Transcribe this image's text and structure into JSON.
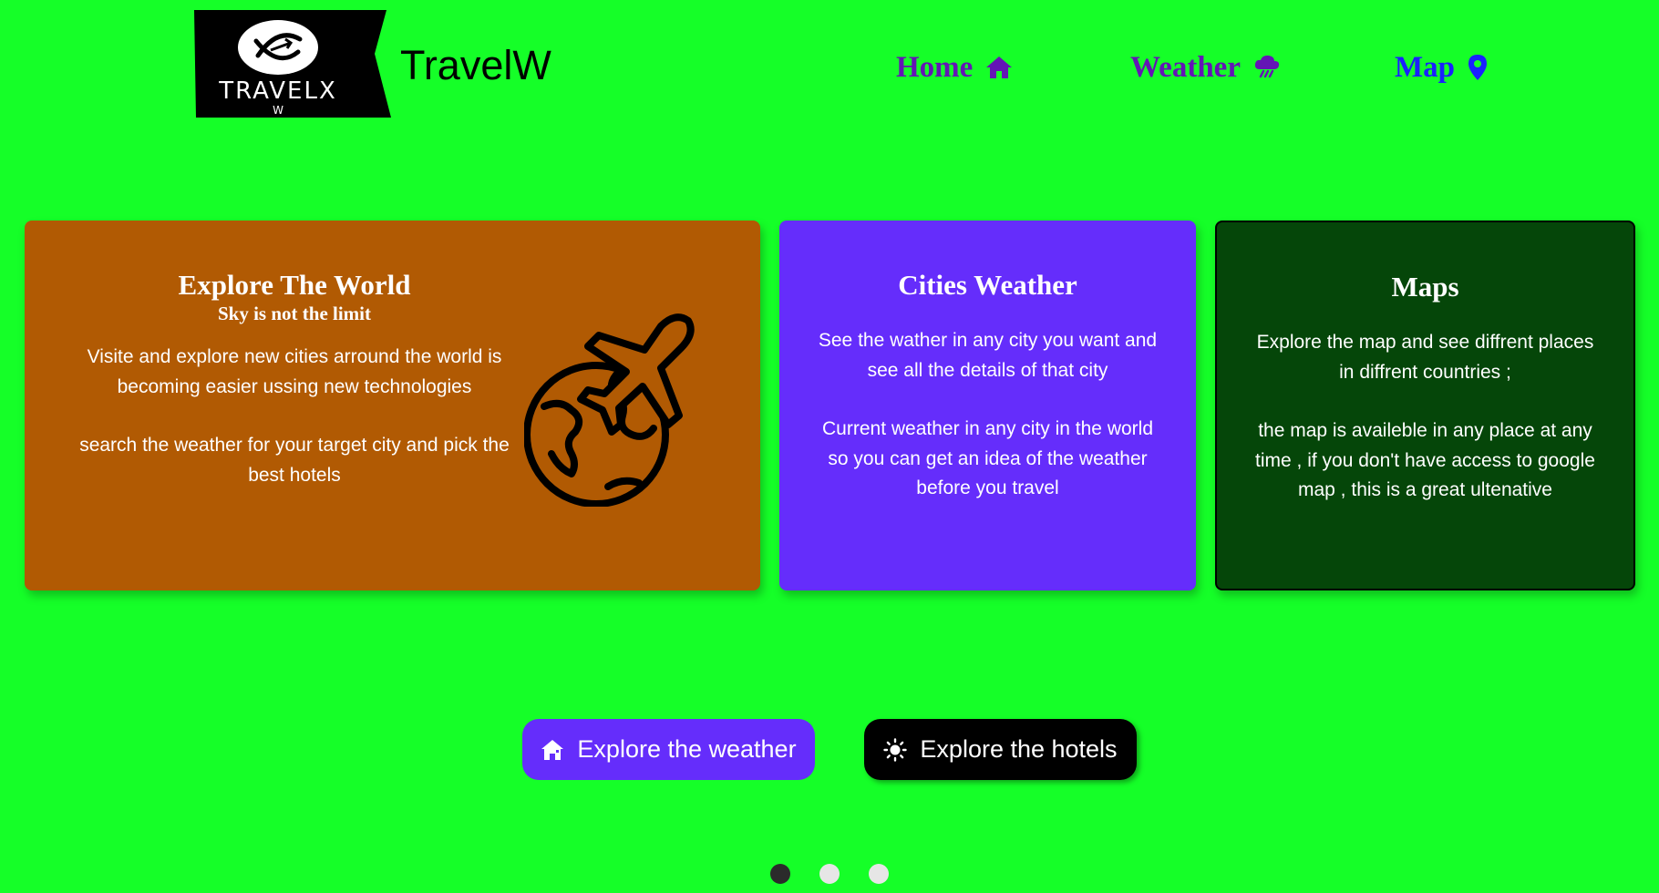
{
  "header": {
    "logo": {
      "text": "TRAVELX",
      "subtext": "W"
    },
    "brand": "TravelW",
    "nav": [
      {
        "label": "Home",
        "icon": "home-icon"
      },
      {
        "label": "Weather",
        "icon": "storm-cloud-icon"
      },
      {
        "label": "Map",
        "icon": "map-pin-icon"
      }
    ]
  },
  "cards": {
    "world": {
      "title": "Explore The World",
      "subtitle": "Sky is not the limit",
      "text1": "Visite and explore new cities arround the world is becoming easier ussing new technologies",
      "text2": "search the weather for your target city and pick the best hotels",
      "icon": "globe-airplane-icon"
    },
    "weather": {
      "title": "Cities Weather",
      "text1": "See the wather in any city you want and see all the details of that city",
      "text2": "Current weather in any city in the world so you can get an idea of the weather before you travel"
    },
    "maps": {
      "title": "Maps",
      "text1": "Explore the map and see diffrent places in diffrent countries ;",
      "text2": "the map is availeble in any place at any time , if you don't have access to google map , this is a great ultenative"
    }
  },
  "buttons": {
    "weather": {
      "label": "Explore the weather",
      "icon": "house-icon"
    },
    "hotels": {
      "label": "Explore the hotels",
      "icon": "sun-icon"
    }
  },
  "carousel": {
    "slide_count": 3,
    "active_index": 0
  },
  "colors": {
    "background": "#15ff28",
    "nav_purple": "#6415b5",
    "nav_blue": "#1a20ff",
    "card_world": "#b15a03",
    "card_weather": "#652dfb",
    "card_maps": "#054609",
    "button_weather": "#652dfb",
    "button_hotels": "#000000",
    "dot_active": "#2b2b2b",
    "dot_inactive": "#e6e6e6"
  }
}
